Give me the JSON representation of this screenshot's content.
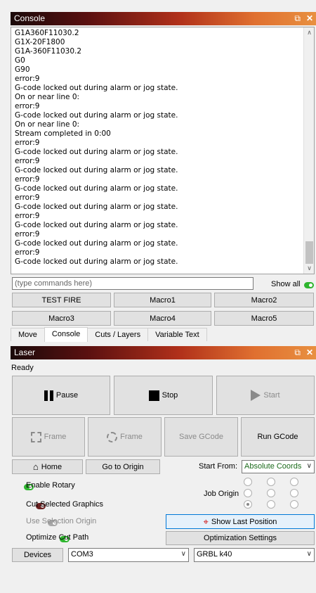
{
  "console_panel": {
    "title": "Console",
    "lines": [
      "G1A360F11030.2",
      "G1X-20F1800",
      "G1A-360F11030.2",
      "G0",
      "G90",
      "error:9",
      "G-code locked out during alarm or jog state.",
      "On or near line 0:",
      "error:9",
      "G-code locked out during alarm or jog state.",
      "On or near line 0:",
      "Stream completed in 0:00",
      "error:9",
      "G-code locked out during alarm or jog state.",
      "error:9",
      "G-code locked out during alarm or jog state.",
      "error:9",
      "G-code locked out during alarm or jog state.",
      "error:9",
      "G-code locked out during alarm or jog state.",
      "error:9",
      "G-code locked out during alarm or jog state.",
      "error:9",
      "G-code locked out during alarm or jog state.",
      "error:9",
      "G-code locked out during alarm or jog state."
    ],
    "command_placeholder": "(type commands here)",
    "show_all_label": "Show all",
    "macro_buttons": [
      "TEST FIRE",
      "Macro1",
      "Macro2",
      "Macro3",
      "Macro4",
      "Macro5"
    ]
  },
  "tabs": [
    "Move",
    "Console",
    "Cuts / Layers",
    "Variable Text"
  ],
  "active_tab": "Console",
  "laser_panel": {
    "title": "Laser",
    "status": "Ready",
    "pause_label": "Pause",
    "stop_label": "Stop",
    "start_label": "Start",
    "frame_label": "Frame",
    "frame_circle_label": "Frame",
    "save_gcode_label": "Save GCode",
    "run_gcode_label": "Run GCode",
    "home_label": "Home",
    "go_to_origin_label": "Go to Origin",
    "start_from_label": "Start From:",
    "start_from_value": "Absolute Coords",
    "enable_rotary_label": "Enable Rotary",
    "cut_selected_label": "Cut Selected Graphics",
    "use_selection_origin_label": "Use Selection Origin",
    "optimize_cut_path_label": "Optimize Cut Path",
    "job_origin_label": "Job Origin",
    "show_last_position_label": "Show Last Position",
    "optimization_settings_label": "Optimization Settings",
    "devices_label": "Devices",
    "port_value": "COM3",
    "device_value": "GRBL k40"
  },
  "colors": {
    "toggle_on": "#2fb52f",
    "toggle_red": "#6b2020",
    "start_from_text": "#1a6a1a"
  }
}
